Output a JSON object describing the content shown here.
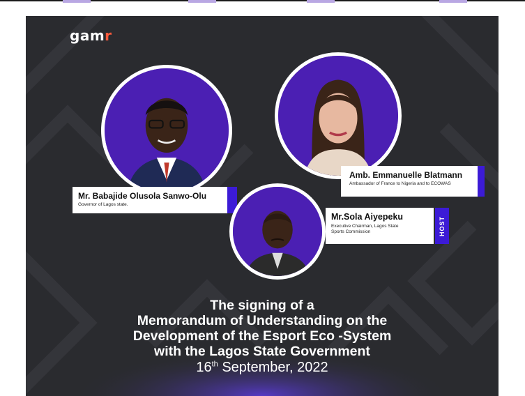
{
  "brand": {
    "logo_main": "gam",
    "logo_accent": "r"
  },
  "speakers": [
    {
      "name": "Mr. Babajide Olusola Sanwo-Olu",
      "role": "Governor of Lagos state."
    },
    {
      "name": "Amb. Emmanuelle Blatmann",
      "role": "Ambassador of France to Nigeria and to ECOWAS"
    },
    {
      "name": "Mr.Sola Aiyepeku",
      "role_line1": "Executive Chairman, Lagos State",
      "role_line2": "Sports Commission",
      "badge": "HOST"
    }
  ],
  "event": {
    "title_lines": [
      "The signing of a",
      "Memorandum of Understanding on the",
      "Development of the Esport Eco -System",
      "with the Lagos State Government"
    ],
    "date_day": "16",
    "date_suffix": "th",
    "date_rest": " September, 2022"
  },
  "colors": {
    "accent_purple": "#4b1fb3",
    "bar_blue": "#3c1bd6",
    "logo_accent": "#ff5a3c",
    "background": "#2a2b2f"
  }
}
